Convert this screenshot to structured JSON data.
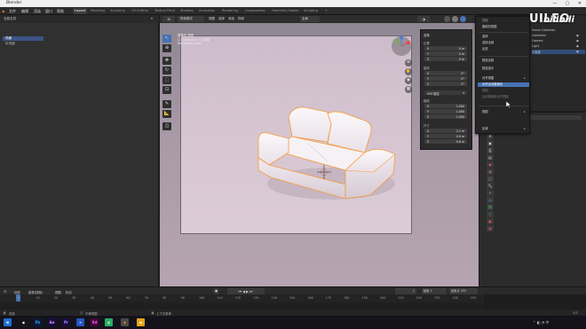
{
  "window": {
    "title": "Blender",
    "minimize": "—",
    "maximize": "▢",
    "close": "✕"
  },
  "menus": [
    "文件",
    "编辑",
    "渲染",
    "窗口",
    "帮助"
  ],
  "workspaces": [
    "Layout",
    "Modeling",
    "Sculpting",
    "UV Editing",
    "Texture Paint",
    "Shading",
    "Animation",
    "Rendering",
    "Compositing",
    "Geometry Nodes",
    "Scripting",
    "+"
  ],
  "left_panel": {
    "header": "当前文件",
    "items": [
      "场景",
      "灯光组"
    ]
  },
  "viewport": {
    "header_mode": "物体模式",
    "view_menu": [
      "视图",
      "选择",
      "添加",
      "物体"
    ],
    "transform_orientation": "全局",
    "info_line1": "摄像机 透视",
    "info_line2": "(1) Collection | 沙发组",
    "info_line3": "Rendering Done"
  },
  "npanel": {
    "title": "变换",
    "location_label": "位置",
    "location": [
      {
        "ax": "X",
        "v": "0 m"
      },
      {
        "ax": "Y",
        "v": "0 m"
      },
      {
        "ax": "Z",
        "v": "0 m"
      }
    ],
    "rotation_label": "旋转",
    "rotation": [
      {
        "ax": "X",
        "v": "0°"
      },
      {
        "ax": "Y",
        "v": "0°"
      },
      {
        "ax": "Z",
        "v": "0°"
      }
    ],
    "mode_label": "XYZ 欧拉",
    "scale_label": "缩放",
    "scale": [
      {
        "ax": "X",
        "v": "1.000"
      },
      {
        "ax": "Y",
        "v": "1.000"
      },
      {
        "ax": "Z",
        "v": "1.000"
      }
    ],
    "dim_label": "尺寸",
    "dims": [
      {
        "ax": "X",
        "v": "2.1 m"
      },
      {
        "ax": "Y",
        "v": "0.9 m"
      },
      {
        "ax": "Z",
        "v": "0.8 m"
      }
    ]
  },
  "context_menu": {
    "items": [
      {
        "label": "视图",
        "kind": "header"
      },
      {
        "label": "摄像机视图",
        "kind": "item"
      },
      {
        "label": "选择",
        "kind": "item"
      },
      {
        "label": "选择全部",
        "kind": "item"
      },
      {
        "label": "反选",
        "kind": "item"
      },
      {
        "label": "框选全部",
        "kind": "item"
      },
      {
        "label": "框选选中",
        "kind": "item"
      },
      {
        "label": "对齐视图",
        "kind": "item"
      },
      {
        "label": "对齐活动摄像机",
        "kind": "highlight"
      },
      {
        "label": "视图",
        "kind": "dim"
      },
      {
        "label": "活动摄像机对齐视图",
        "kind": "dim"
      },
      {
        "label": "视图",
        "kind": "item"
      },
      {
        "label": "区域",
        "kind": "item"
      }
    ]
  },
  "watermark": {
    "text1": "UILEO",
    "text2": "bilibili"
  },
  "outliner": {
    "rows": [
      "Scene Collection",
      "Collection",
      "Camera",
      "Light",
      "沙发组"
    ]
  },
  "timeline": {
    "menu": [
      "回放",
      "抠像(插帧)",
      "视图",
      "标记"
    ],
    "start_label": "起始",
    "start": "1",
    "end_label": "结束点",
    "end": "250",
    "current": "1",
    "ticks": [
      "0",
      "10",
      "20",
      "30",
      "40",
      "50",
      "60",
      "70",
      "80",
      "90",
      "100",
      "110",
      "120",
      "130",
      "140",
      "150",
      "160",
      "170",
      "180",
      "190",
      "200",
      "210",
      "220",
      "230",
      "240",
      "250"
    ]
  },
  "statusbar": {
    "left": "选择",
    "middle": "平移视图",
    "right": "上下文菜单",
    "version": "3.0"
  },
  "taskbar": {
    "icons": [
      "Ps",
      "Ae",
      "Pr",
      "Xd"
    ]
  },
  "colors": {
    "accent": "#4772b3",
    "object_outline": "#f59a3b"
  }
}
